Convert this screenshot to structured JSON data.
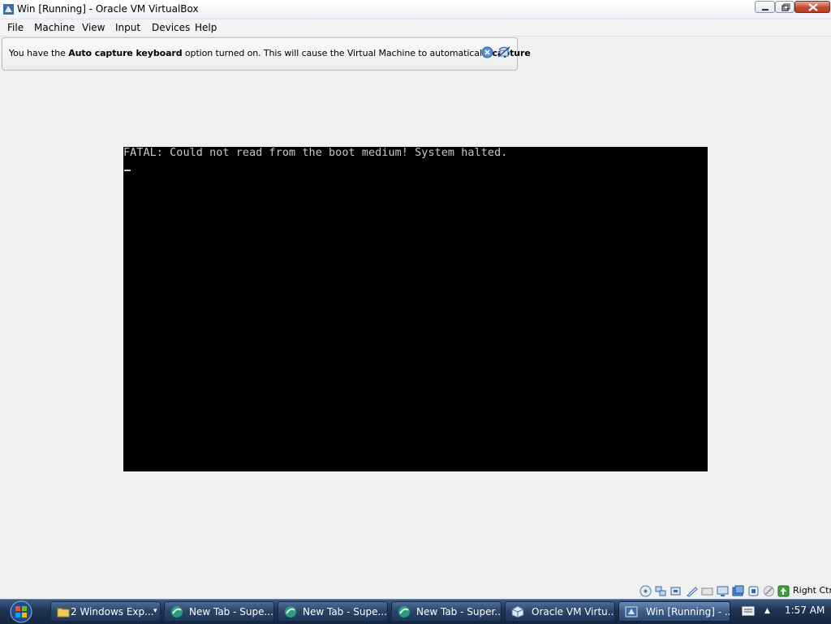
{
  "window": {
    "title": "Win [Running] - Oracle VM VirtualBox"
  },
  "menu": [
    "File",
    "Machine",
    "View",
    "Input",
    "Devices",
    "Help"
  ],
  "notice": {
    "part1": "You have the ",
    "bold1": "Auto capture keyboard",
    "part2": " option turned on. This will cause the Virtual Machine to automatically ",
    "bold2": "capture"
  },
  "vm": {
    "message": "FATAL: Could not read from the boot medium! System halted.",
    "text_color": "#c8c8c8",
    "background": "#000000"
  },
  "statusbar": {
    "icons": [
      "optical-drive-icon",
      "network-icon",
      "usb-icon",
      "shared-folders-icon",
      "floppy-icon",
      "display-icon",
      "hard-disk-icon",
      "video-capture-icon",
      "mouse-integration-icon",
      "host-key-icon"
    ],
    "host_key": "Right Ctrl"
  },
  "taskbar": {
    "items": [
      {
        "label": "2 Windows Exp...",
        "icon": "folder-icon"
      },
      {
        "label": "New Tab - Supe...",
        "icon": "browser-icon"
      },
      {
        "label": "New Tab - Supe...",
        "icon": "browser-icon"
      },
      {
        "label": "New Tab - Super...",
        "icon": "browser-icon"
      },
      {
        "label": "Oracle VM Virtu...",
        "icon": "virtualbox-icon"
      },
      {
        "label": "Win [Running] - ...",
        "icon": "virtualbox-vm-icon",
        "active": true
      }
    ],
    "clock": "1:57 AM"
  }
}
